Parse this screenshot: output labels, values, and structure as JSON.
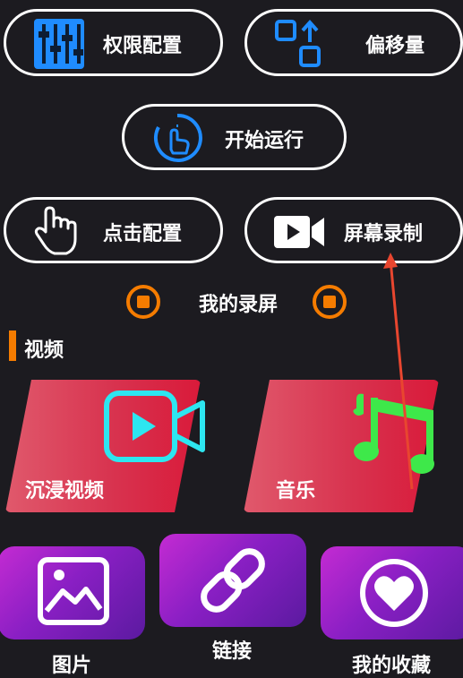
{
  "buttons": {
    "permission": "权限配置",
    "offset": "偏移量",
    "start": "开始运行",
    "click_config": "点击配置",
    "screen_record": "屏幕录制"
  },
  "my_recordings": "我的录屏",
  "section": {
    "title": "视频"
  },
  "cards": {
    "immersive_video": "沉浸视频",
    "music": "音乐"
  },
  "tiles": {
    "pictures": "图片",
    "links": "链接",
    "favorites": "我的收藏"
  },
  "colors": {
    "accent_blue": "#1f8cff",
    "accent_orange": "#f57c00",
    "card_red": "#d8334f",
    "video_icon_cyan": "#2de6f0",
    "music_icon_green": "#3ee84a",
    "tile_purple": "#8a1fc4",
    "arrow": "#e8462f"
  }
}
